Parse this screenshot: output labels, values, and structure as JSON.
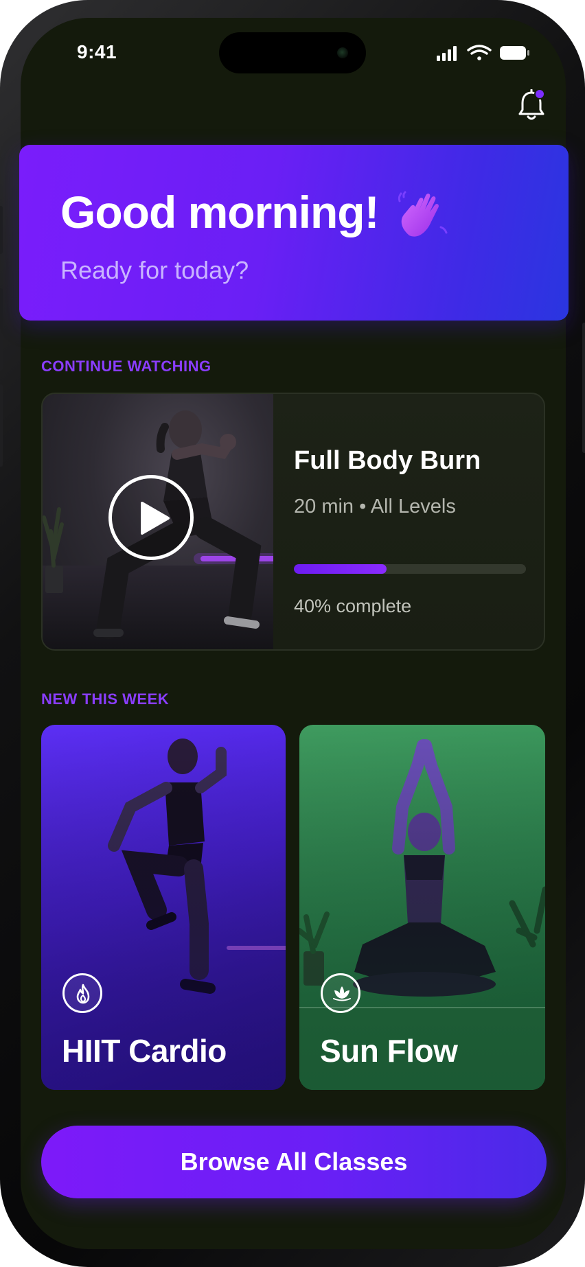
{
  "status_bar": {
    "time": "9:41"
  },
  "header": {
    "notification_icon": "bell-icon",
    "has_unread": true
  },
  "greeting": {
    "title": "Good morning!",
    "emoji": "waving-hand",
    "subtitle": "Ready for today?"
  },
  "continue_watching": {
    "section_label": "CONTINUE WATCHING",
    "title": "Full Body Burn",
    "meta": "20 min • All Levels",
    "progress": 0.4,
    "progress_text": "40% complete"
  },
  "new_this_week": {
    "section_label": "NEW THIS WEEK",
    "classes": [
      {
        "name": "HIIT Cardio",
        "icon": "flame-icon",
        "color": "#4a22d9"
      },
      {
        "name": "Sun Flow",
        "icon": "lotus-icon",
        "color": "#2e8852"
      }
    ]
  },
  "cta": {
    "label": "Browse All Classes"
  },
  "colors": {
    "accent": "#7a1dfb",
    "background": "#141a0c",
    "accent_text": "#8a3dff"
  }
}
